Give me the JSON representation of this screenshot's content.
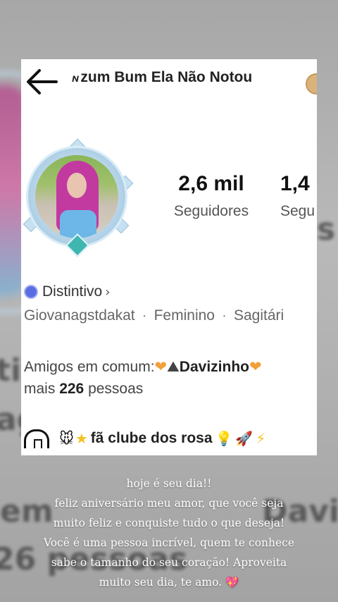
{
  "header": {
    "back_icon": "arrow-left-icon",
    "title": "zum Bum Ela Não Notou"
  },
  "profile": {
    "avatar_icon": "avatar-photo",
    "stats": [
      {
        "value": "2,6 mil",
        "label": "Seguidores"
      },
      {
        "value": "1,4",
        "label": "Segu"
      }
    ],
    "badge_label": "Distintivo",
    "info": {
      "username": "Giovanagstdakat",
      "gender": "Feminino",
      "sign": "Sagitári"
    },
    "friends": {
      "prefix": "Amigos em comum:",
      "name": "Davizinho",
      "more_prefix": "mais",
      "count": "226",
      "more_suffix": "pessoas"
    },
    "club": {
      "label": "fã clube dos rosa"
    }
  },
  "caption": {
    "lines": [
      "hoje é seu dia!!",
      "feliz aniversário meu amor, que você seja",
      "muito feliz e conquiste tudo o que deseja!",
      "Você é uma pessoa incrível, quem te conhece",
      "sabe o tamanho do seu coração! Aproveita",
      "muito seu dia, te amo."
    ]
  },
  "backdrop": {
    "texts": [
      "ti",
      "ag",
      "em",
      "26 pessoas",
      "Daviz",
      "s"
    ]
  },
  "colors": {
    "card_bg": "#ffffff",
    "backdrop": "#9a9a9a",
    "accent_heart": "#f2a03a",
    "pink_heart": "#ff4f9a"
  }
}
